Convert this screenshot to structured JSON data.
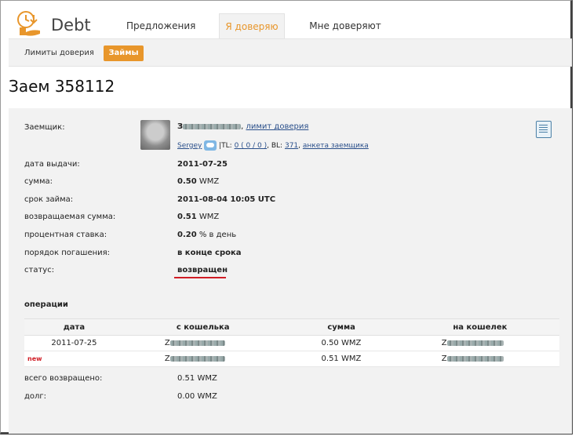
{
  "header": {
    "brand": "Debt",
    "tabs": [
      {
        "label": "Предложения"
      },
      {
        "label": "Я доверяю"
      },
      {
        "label": "Мне доверяют"
      }
    ]
  },
  "subnav": {
    "items": [
      {
        "label": "Лимиты доверия"
      },
      {
        "label": "Займы"
      }
    ]
  },
  "page": {
    "title": "Заем 358112"
  },
  "borrower": {
    "label": "Заемщик:",
    "name_initial": "З",
    "limit_link": "лимит доверия",
    "sergey": "Sergey",
    "tl_prefix": "TL:",
    "tl_value": "0 ( 0 / 0 )",
    "bl_prefix": "BL:",
    "bl_value": "371",
    "profile_link": "анкета заемщика"
  },
  "details": {
    "issue_date_label": "дата выдачи:",
    "issue_date": "2011-07-25",
    "amount_label": "сумма:",
    "amount": "0.50",
    "amount_unit": "WMZ",
    "term_label": "срок займа:",
    "term": "2011-08-04 10:05 UTC",
    "return_label": "возвращаемая сумма:",
    "return_amount": "0.51",
    "return_unit": "WMZ",
    "rate_label": "процентная ставка:",
    "rate": "0.20",
    "rate_suffix": "% в день",
    "repay_label": "порядок погашения:",
    "repay": "в конце срока",
    "status_label": "статус:",
    "status": "возвращен"
  },
  "operations": {
    "title": "операции",
    "columns": [
      "дата",
      "с кошелька",
      "сумма",
      "на кошелек"
    ],
    "rows": [
      {
        "date": "2011-07-25",
        "from": "Z",
        "amount": "0.50 WMZ",
        "to": "Z"
      },
      {
        "date": "new",
        "from": "Z",
        "amount": "0.51 WMZ",
        "to": "Z"
      }
    ]
  },
  "totals": {
    "returned_label": "всего возвращено:",
    "returned": "0.51 WMZ",
    "debt_label": "долг:",
    "debt": "0.00 WMZ"
  },
  "colors": {
    "accent": "#e8962b",
    "status_underline": "#d01c24",
    "link": "#2a4f8a"
  }
}
